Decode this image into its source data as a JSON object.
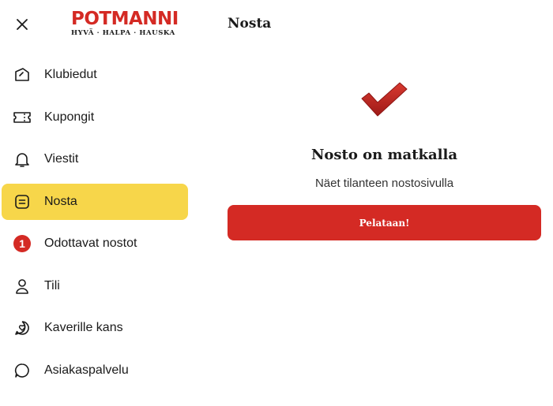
{
  "brand": {
    "name": "POTMANNI",
    "tagline": "HYVÄ · HALPA · HAUSKA",
    "color": "#d42a24"
  },
  "header": {
    "title": "Nosta"
  },
  "sidebar": {
    "close_icon": "close-icon",
    "items": [
      {
        "label": "Klubiedut",
        "icon": "ticket-tag-icon"
      },
      {
        "label": "Kupongit",
        "icon": "coupon-icon"
      },
      {
        "label": "Viestit",
        "icon": "bell-icon"
      },
      {
        "label": "Nosta",
        "icon": "withdraw-icon",
        "active": true
      },
      {
        "label": "Odottavat nostot",
        "icon": "pending-badge",
        "badge": "1"
      },
      {
        "label": "Tili",
        "icon": "user-icon"
      },
      {
        "label": "Kaverille kans",
        "icon": "heart-chat-icon"
      },
      {
        "label": "Asiakaspalvelu",
        "icon": "chat-bubble-icon"
      }
    ],
    "active_color": "#f7d64a"
  },
  "main": {
    "status_icon": "checkmark-icon",
    "heading": "Nosto on matkalla",
    "subtext": "Näet tilanteen nostosivulla",
    "cta_label": "Pelataan!"
  }
}
